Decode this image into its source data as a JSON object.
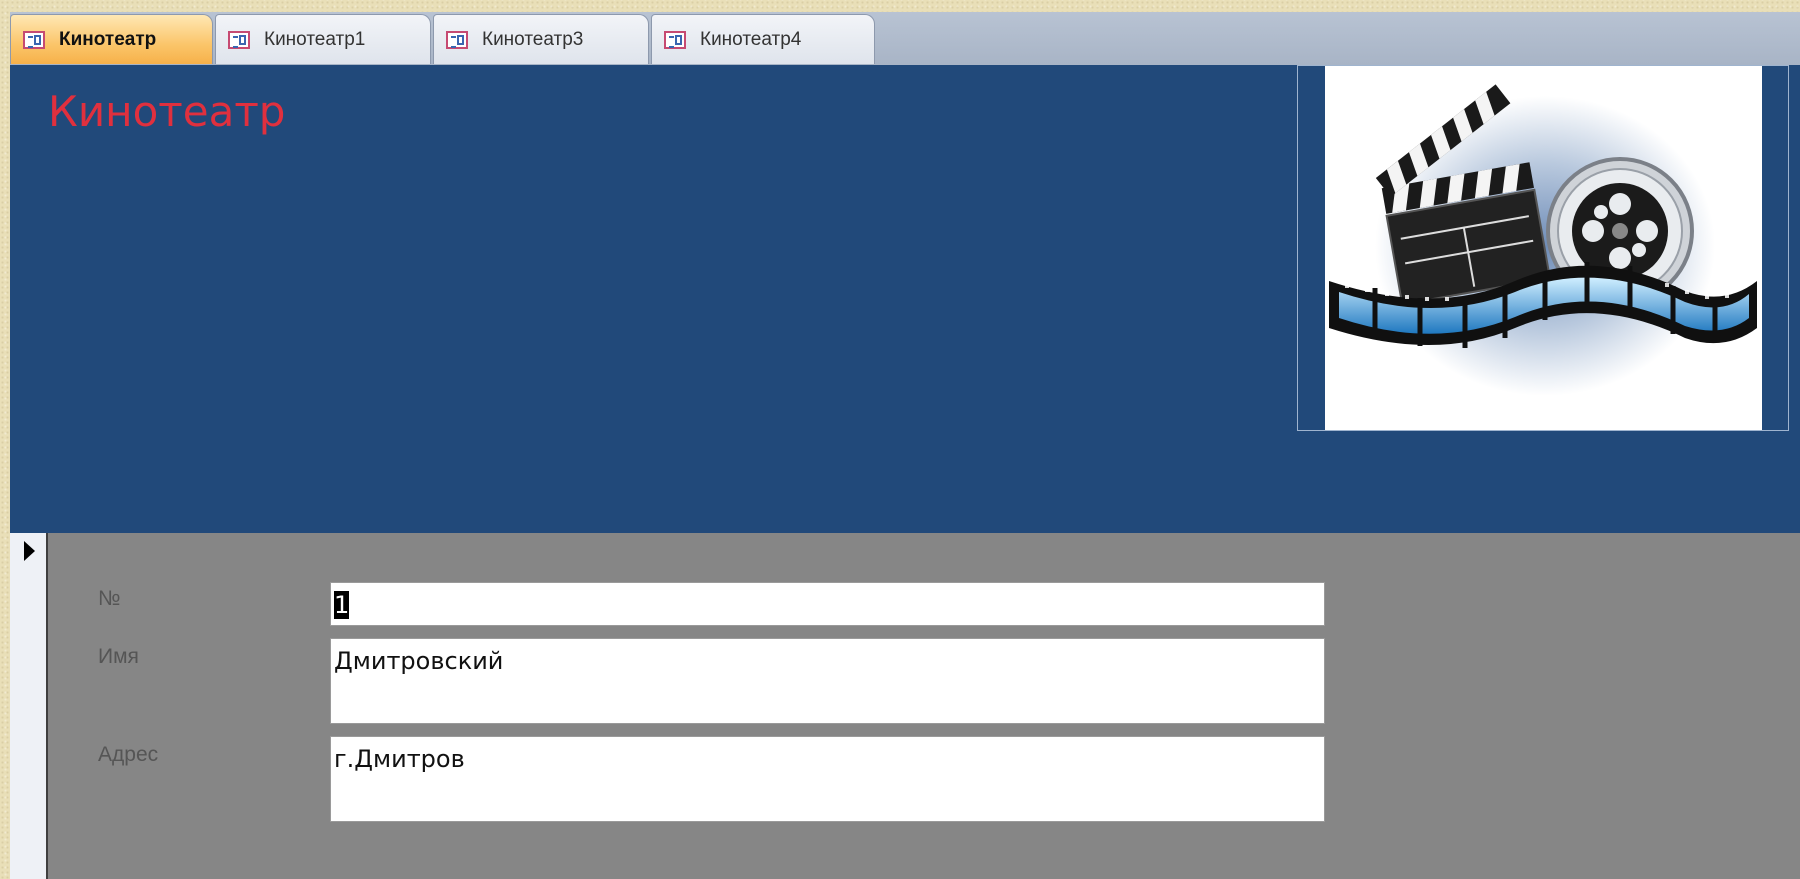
{
  "tabs": [
    {
      "label": "Кинотеатр",
      "active": true
    },
    {
      "label": "Кинотеатр1",
      "active": false
    },
    {
      "label": "Кинотеатр3",
      "active": false
    },
    {
      "label": "Кинотеатр4",
      "active": false
    }
  ],
  "header": {
    "title": "Кинотеатр",
    "title_color": "#e0303e",
    "background": "#21497a",
    "logo_icon": "film-clapperboard-reel-logo"
  },
  "fields": {
    "number": {
      "label": "№",
      "value": "1"
    },
    "name": {
      "label": "Имя",
      "value": "Дмитровский"
    },
    "address": {
      "label": "Адрес",
      "value": "г.Дмитров"
    }
  },
  "colors": {
    "detail_background": "#868686",
    "active_tab": "#f6b14a"
  }
}
